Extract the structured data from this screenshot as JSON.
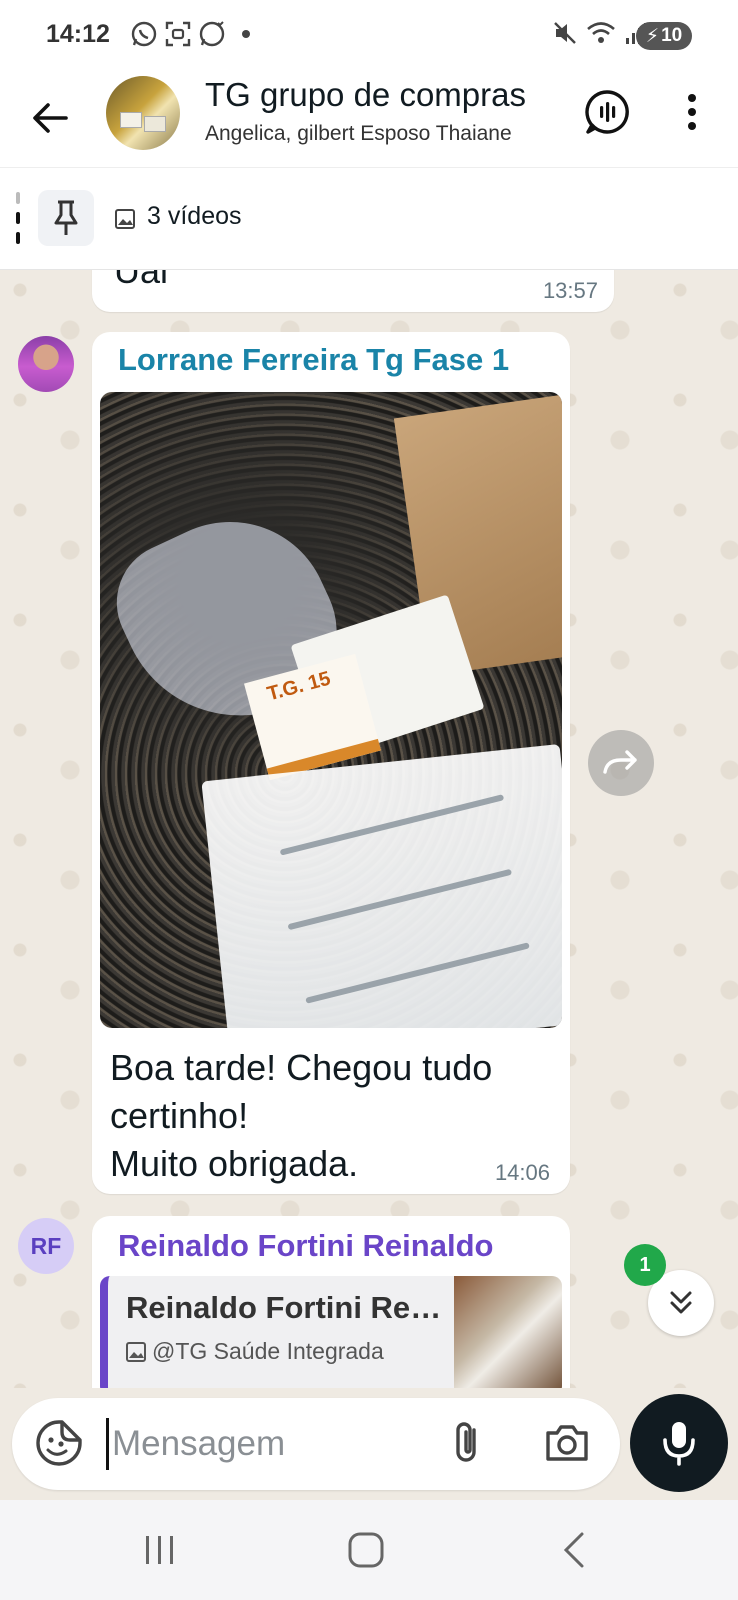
{
  "status_bar": {
    "time": "14:12",
    "battery": "10",
    "left_icons": [
      "whatsapp-icon",
      "scan-icon",
      "whatsapp-business-icon",
      "dot-icon"
    ],
    "right_icons": [
      "mute-icon",
      "wifi-icon",
      "signal-icon",
      "signal-icon",
      "battery-charging-icon"
    ]
  },
  "header": {
    "title": "TG grupo de compras",
    "subtitle": "Angelica, gilbert Esposo Thaiane"
  },
  "pinned": {
    "text": "3 vídeos"
  },
  "messages": {
    "previous": {
      "text": "Uai",
      "time": "13:57"
    },
    "photo_message": {
      "sender": "Lorrane Ferreira Tg Fase 1",
      "caption": "Boa tarde! Chegou tudo certinho!\nMuito obrigada.",
      "time": "14:06",
      "photo_box_label": "T.G. 15"
    },
    "reply_message": {
      "avatar_initials": "RF",
      "sender": "Reinaldo Fortini Reinaldo",
      "quote_title": "Reinaldo Fortini Reinaldo",
      "quote_subtitle": "@TG Saúde Integrada"
    }
  },
  "unread_count": "1",
  "input": {
    "placeholder": "Mensagem"
  },
  "colors": {
    "sender_lorrane": "#1a84a8",
    "sender_reinaldo": "#6a45c8",
    "chat_background": "#efeae2",
    "unread_badge": "#21a84a"
  }
}
